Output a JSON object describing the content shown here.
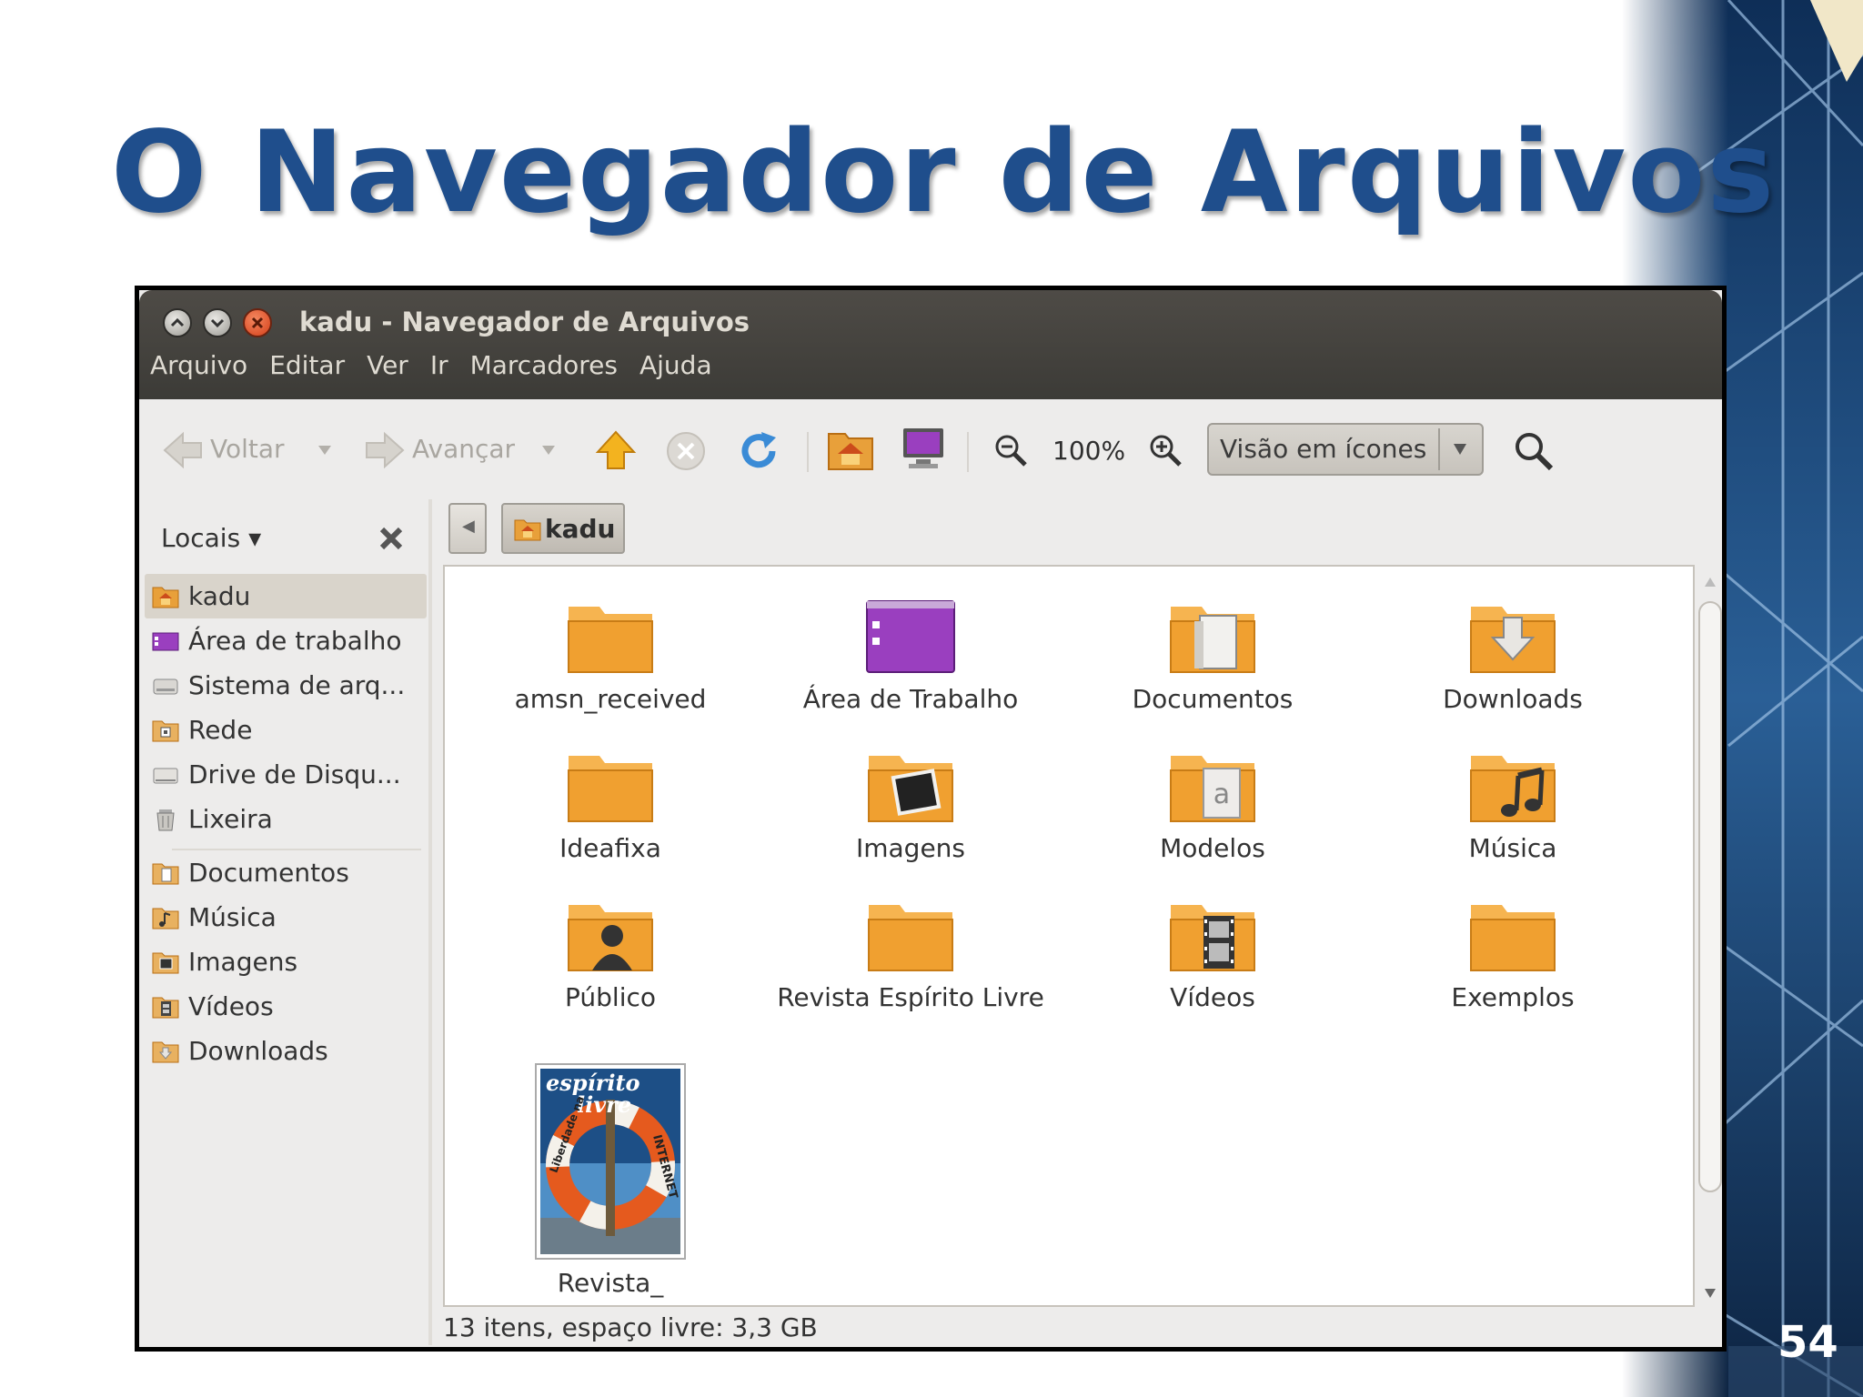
{
  "slide": {
    "title": "O Navegador de Arquivos",
    "page_number": "54"
  },
  "window": {
    "title": "kadu - Navegador de Arquivos",
    "menu": [
      "Arquivo",
      "Editar",
      "Ver",
      "Ir",
      "Marcadores",
      "Ajuda"
    ]
  },
  "toolbar": {
    "back_label": "Voltar",
    "forward_label": "Avançar",
    "zoom_level": "100%",
    "view_mode": "Visão em ícones"
  },
  "sidebar": {
    "header": "Locais",
    "items": [
      {
        "label": "kadu",
        "icon": "home-folder-icon",
        "selected": true
      },
      {
        "label": "Área de trabalho",
        "icon": "desktop-icon"
      },
      {
        "label": "Sistema de arq...",
        "icon": "drive-icon"
      },
      {
        "label": "Rede",
        "icon": "network-icon"
      },
      {
        "label": "Drive de Disqu...",
        "icon": "floppy-icon"
      },
      {
        "label": "Lixeira",
        "icon": "trash-icon"
      },
      {
        "label": "Documentos",
        "icon": "documents-folder-icon"
      },
      {
        "label": "Música",
        "icon": "music-folder-icon"
      },
      {
        "label": "Imagens",
        "icon": "pictures-folder-icon"
      },
      {
        "label": "Vídeos",
        "icon": "videos-folder-icon"
      },
      {
        "label": "Downloads",
        "icon": "downloads-folder-icon"
      }
    ]
  },
  "pathbar": {
    "current": "kadu"
  },
  "files": [
    {
      "label": "amsn_received",
      "icon": "folder-icon"
    },
    {
      "label": "Área de Trabalho",
      "icon": "desktop-folder-icon"
    },
    {
      "label": "Documentos",
      "icon": "documents-folder-icon"
    },
    {
      "label": "Downloads",
      "icon": "downloads-folder-icon"
    },
    {
      "label": "Ideafixa",
      "icon": "folder-icon"
    },
    {
      "label": "Imagens",
      "icon": "pictures-folder-icon"
    },
    {
      "label": "Modelos",
      "icon": "templates-folder-icon"
    },
    {
      "label": "Música",
      "icon": "music-folder-icon"
    },
    {
      "label": "Público",
      "icon": "public-folder-icon"
    },
    {
      "label": "Revista Espírito Livre",
      "icon": "folder-icon"
    },
    {
      "label": "Vídeos",
      "icon": "videos-folder-icon"
    },
    {
      "label": "Exemplos",
      "icon": "folder-icon"
    },
    {
      "label": "Revista_",
      "icon": "magazine-thumbnail-icon",
      "thumb_text": [
        "espírito",
        "livre",
        "Liberdade na",
        "INTERNET"
      ]
    }
  ],
  "status": {
    "text": "13 itens, espaço livre: 3,3 GB"
  },
  "colors": {
    "title_blue": "#1f4e8c",
    "titlebar_dark": "#3c3b37",
    "folder_orange": "#f0a030",
    "close_red": "#d4401a"
  }
}
